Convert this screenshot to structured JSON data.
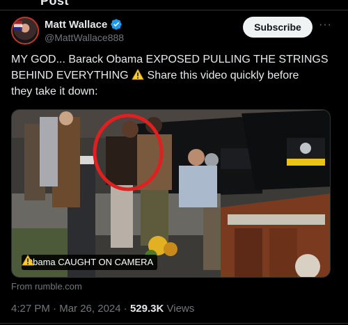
{
  "header": {
    "cut_title": "Post"
  },
  "author": {
    "display_name": "Matt Wallace",
    "handle": "@MattWallace888",
    "verified": true
  },
  "actions": {
    "subscribe_label": "Subscribe",
    "more_icon": "more-horizontal-icon"
  },
  "tweet": {
    "line1": "MY GOD... Barack Obama EXPOSED PULLING THE STRINGS",
    "line2_a": "BEHIND EVERYTHING",
    "line2_b": "Share this video quickly before",
    "line3": "they take it down:"
  },
  "media": {
    "caption": "Obama CAUGHT ON CAMERA",
    "highlight_color": "#e02020",
    "source": "From rumble.com"
  },
  "meta": {
    "time": "4:27 PM",
    "sep1": "·",
    "date": "Mar 26, 2024",
    "sep2": "·",
    "views_count": "529.3K",
    "views_label": "Views"
  },
  "colors": {
    "accent": "#1d9bf0",
    "muted": "#71767b",
    "text": "#e7e9ea",
    "background": "#000000"
  }
}
